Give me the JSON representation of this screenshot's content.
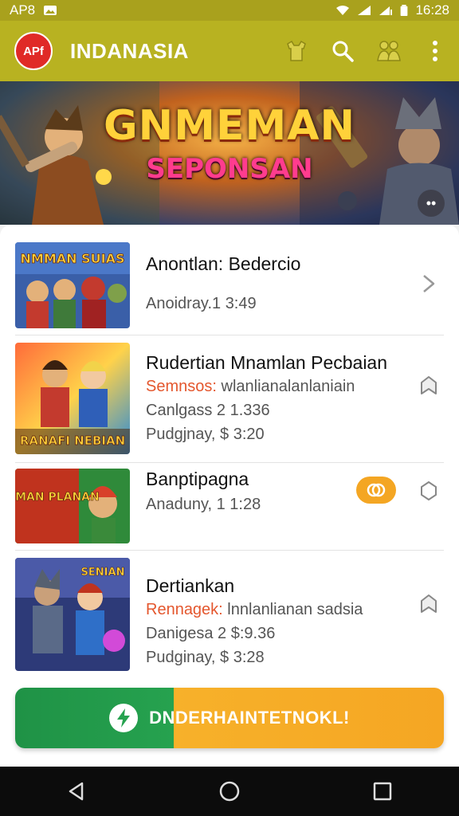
{
  "status_bar": {
    "carrier": "AP8",
    "time": "16:28"
  },
  "toolbar": {
    "logo_text": "APf",
    "title": "INDANASIA",
    "actions": [
      "shop-icon",
      "search-icon",
      "team-icon",
      "more-vert-icon"
    ]
  },
  "banner": {
    "title": "GNMEMAN",
    "subtitle": "SEPONSAN",
    "more_label": "••"
  },
  "list": {
    "items": [
      {
        "title": "Anontlan: Bedercio",
        "lines": [
          {
            "text": "Anoidray.1 3:49"
          }
        ],
        "thumb_text": "NMMAN SUIAS",
        "trail": "chevron-right-icon"
      },
      {
        "title": "Rudertian Mnamlan Pecbaian",
        "lines": [
          {
            "highlight": "Semnsos:",
            "text": " wlanlianalanlaniain"
          },
          {
            "text": "Canlgass 2 1.336"
          },
          {
            "text": "Pudgjnay, $ 3:20"
          }
        ],
        "thumb_text": "RANAFI NEBIAN",
        "trail": "bookmark-icon"
      },
      {
        "title": "Banptipagna",
        "lines": [
          {
            "text": "Anaduny, 1 1:28"
          }
        ],
        "thumb_text": "SNMAN PLANAN",
        "badge": "coin-icon",
        "trail": "hexagon-icon"
      },
      {
        "title": "Dertiankan",
        "lines": [
          {
            "highlight": "Rennagek:",
            "text": " lnnlanlianan sadsia"
          },
          {
            "text": "Danigesa 2 $:9.36"
          },
          {
            "text": "Pudginay, $ 3:28"
          }
        ],
        "thumb_text": "SENIAN",
        "trail": "bookmark-icon"
      }
    ]
  },
  "cta": {
    "label": "DNDERHAINTETNOKL!"
  },
  "colors": {
    "status_bar": "#a9a11d",
    "toolbar": "#b8b221",
    "accent_orange": "#f5a623",
    "accent_green": "#26a24f",
    "highlight": "#e4572e"
  }
}
